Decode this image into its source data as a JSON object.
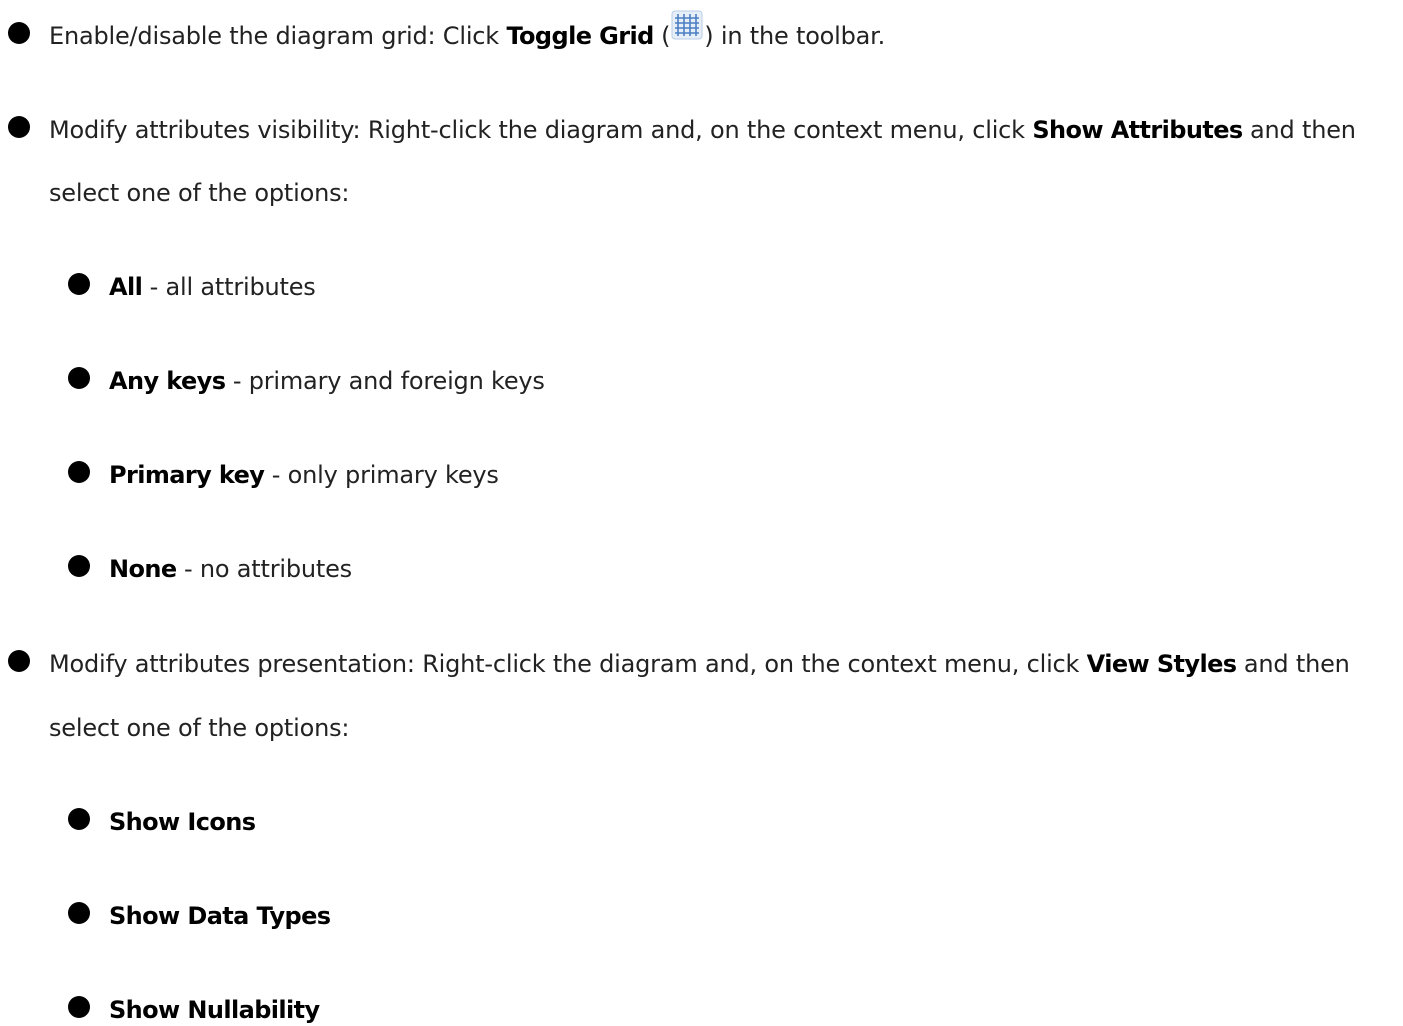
{
  "items": [
    {
      "prefix": "Enable/disable the diagram grid: Click ",
      "bold": "Toggle Grid",
      "mid": " (",
      "icon": "grid-icon",
      "suffix": ") in the toolbar."
    },
    {
      "line1_prefix": "Modify attributes visibility: Right-click the diagram and, on the context menu, click ",
      "bold": "Show Attributes",
      "line1_suffix": " and then",
      "line2": "select one of the options:",
      "options": [
        {
          "bold": "All",
          "text": " - all attributes"
        },
        {
          "bold": "Any keys",
          "text": " - primary and foreign keys"
        },
        {
          "bold": "Primary key",
          "text": " - only primary keys"
        },
        {
          "bold": "None",
          "text": " - no attributes"
        }
      ]
    },
    {
      "line1_prefix": "Modify attributes presentation: Right-click the diagram and, on the context menu, click ",
      "bold": "View Styles",
      "line1_suffix": " and then",
      "line2": "select one of the options:",
      "options": [
        {
          "bold": "Show Icons"
        },
        {
          "bold": "Show Data Types"
        },
        {
          "bold": "Show Nullability"
        }
      ]
    }
  ]
}
